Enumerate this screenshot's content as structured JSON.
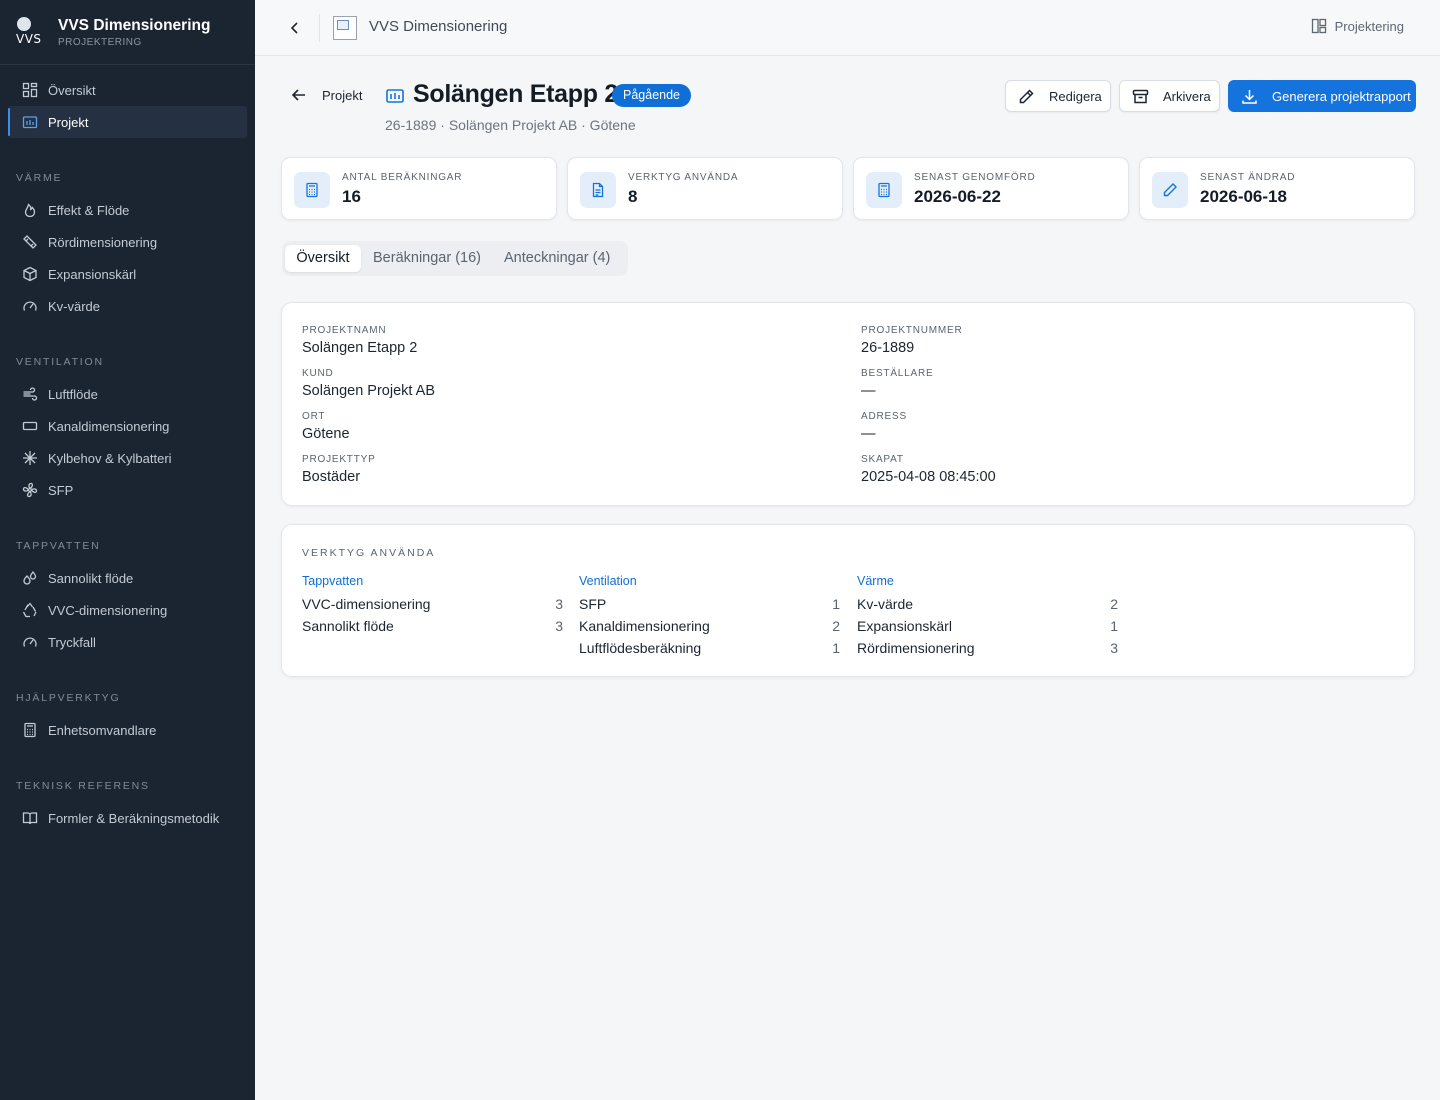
{
  "brand": {
    "logo_text": "VVS",
    "title": "VVS Dimensionering",
    "subtitle": "PROJEKTERING"
  },
  "sidebar": {
    "top_items": [
      {
        "label": "Översikt",
        "icon": "grid-icon"
      },
      {
        "label": "Projekt",
        "icon": "folder-icon",
        "active": true
      }
    ],
    "sections": [
      {
        "title": "VÄRME",
        "items": [
          {
            "label": "Effekt & Flöde",
            "icon": "flame-icon"
          },
          {
            "label": "Rördimensionering",
            "icon": "pipe-icon"
          },
          {
            "label": "Expansionskärl",
            "icon": "box-icon"
          },
          {
            "label": "Kv-värde",
            "icon": "gauge-icon"
          }
        ]
      },
      {
        "title": "VENTILATION",
        "items": [
          {
            "label": "Luftflöde",
            "icon": "wind-icon"
          },
          {
            "label": "Kanaldimensionering",
            "icon": "duct-icon"
          },
          {
            "label": "Kylbehov & Kylbatteri",
            "icon": "snowflake-icon"
          },
          {
            "label": "SFP",
            "icon": "fan-icon"
          }
        ]
      },
      {
        "title": "TAPPVATTEN",
        "items": [
          {
            "label": "Sannolikt flöde",
            "icon": "droplets-icon"
          },
          {
            "label": "VVC-dimensionering",
            "icon": "recycle-icon"
          },
          {
            "label": "Tryckfall",
            "icon": "gauge-icon"
          }
        ]
      },
      {
        "title": "HJÄLPVERKTYG",
        "items": [
          {
            "label": "Enhetsomvandlare",
            "icon": "calculator-icon"
          }
        ]
      },
      {
        "title": "TEKNISK REFERENS",
        "items": [
          {
            "label": "Formler & Beräkningsmetodik",
            "icon": "book-icon"
          }
        ]
      }
    ]
  },
  "topbar": {
    "title": "VVS Dimensionering",
    "right_label": "Projektering"
  },
  "header": {
    "back_label": "Projekt",
    "title": "Solängen Etapp 2",
    "badge": "Pågående",
    "subtitle": "26-1889 · Solängen Projekt AB · Götene",
    "edit_label": "Redigera",
    "archive_label": "Arkivera",
    "report_label": "Generera projektrapport"
  },
  "stats": [
    {
      "label": "ANTAL BERÄKNINGAR",
      "value": "16",
      "icon": "calculator-icon"
    },
    {
      "label": "VERKTYG ANVÄNDA",
      "value": "8",
      "icon": "file-icon"
    },
    {
      "label": "SENAST GENOMFÖRD",
      "value": "2026-06-22",
      "icon": "calculator-icon"
    },
    {
      "label": "SENAST ÄNDRAD",
      "value": "2026-06-18",
      "icon": "pencil-icon"
    }
  ],
  "tabs": [
    "Översikt",
    "Beräkningar (16)",
    "Anteckningar (4)"
  ],
  "info": {
    "project_name_label": "PROJEKTNAMN",
    "project_name": "Solängen Etapp 2",
    "project_number_label": "PROJEKTNUMMER",
    "project_number": "26-1889",
    "customer_label": "KUND",
    "customer": "Solängen Projekt AB",
    "orderer_label": "BESTÄLLARE",
    "orderer": "—",
    "city_label": "ORT",
    "city": "Götene",
    "address_label": "ADRESS",
    "address": "—",
    "type_label": "PROJEKTTYP",
    "type": "Bostäder",
    "created_label": "SKAPAT",
    "created": "2025-04-08 08:45:00"
  },
  "tools": {
    "title": "VERKTYG ANVÄNDA",
    "groups": [
      {
        "name": "Tappvatten",
        "rows": [
          {
            "name": "VVC-dimensionering",
            "count": "3"
          },
          {
            "name": "Sannolikt flöde",
            "count": "3"
          }
        ]
      },
      {
        "name": "Ventilation",
        "rows": [
          {
            "name": "SFP",
            "count": "1"
          },
          {
            "name": "Kanaldimensionering",
            "count": "2"
          },
          {
            "name": "Luftflödesberäkning",
            "count": "1"
          }
        ]
      },
      {
        "name": "Värme",
        "rows": [
          {
            "name": "Kv-värde",
            "count": "2"
          },
          {
            "name": "Expansionskärl",
            "count": "1"
          },
          {
            "name": "Rördimensionering",
            "count": "3"
          }
        ]
      }
    ]
  },
  "colors": {
    "sidebar_bg": "#1b2532",
    "accent": "#1573de",
    "badge": "#0f6fd6"
  }
}
